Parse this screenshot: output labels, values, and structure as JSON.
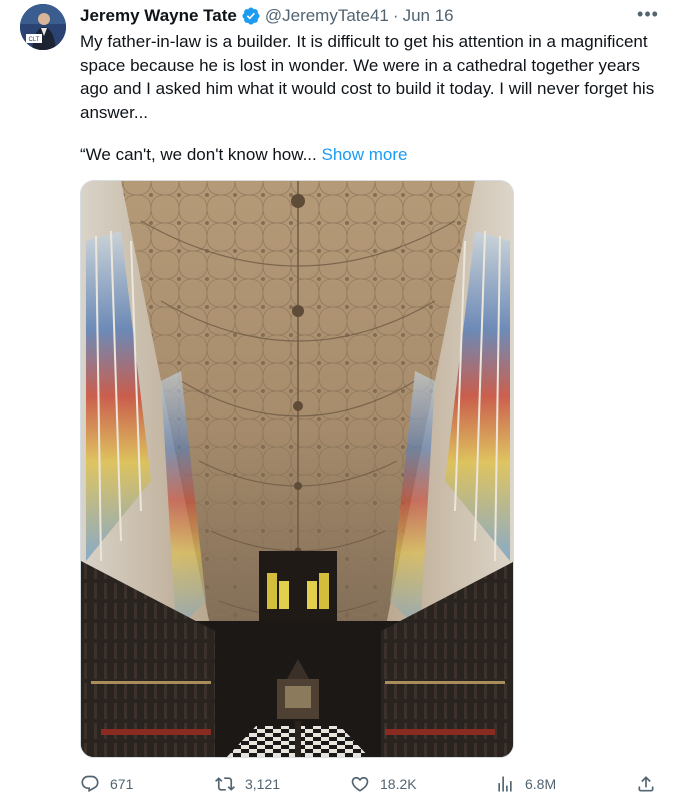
{
  "author": {
    "display_name": "Jeremy Wayne Tate",
    "handle": "@JeremyTate41",
    "separator": "·",
    "date": "Jun 16",
    "verified": true,
    "avatar_badge": "CLT"
  },
  "tweet": {
    "paragraph1": "My father-in-law is a builder. It is difficult to get his attention in a magnificent space because he is lost in wonder. We were in a cathedral together years ago and I asked him what it would cost to build it today. I will never forget his answer...",
    "paragraph2": "“We can't, we don't know how...",
    "show_more": "Show more"
  },
  "stats": {
    "replies": "671",
    "retweets": "3,121",
    "likes": "18.2K",
    "views": "6.8M"
  },
  "icons": {
    "verified": "verified-badge-icon",
    "more": "more-options-icon",
    "reply": "reply-icon",
    "retweet": "retweet-icon",
    "like": "heart-icon",
    "views": "views-chart-icon",
    "share": "share-icon"
  },
  "colors": {
    "accent": "#1d9bf0",
    "text": "#0f1419",
    "muted": "#536471"
  }
}
